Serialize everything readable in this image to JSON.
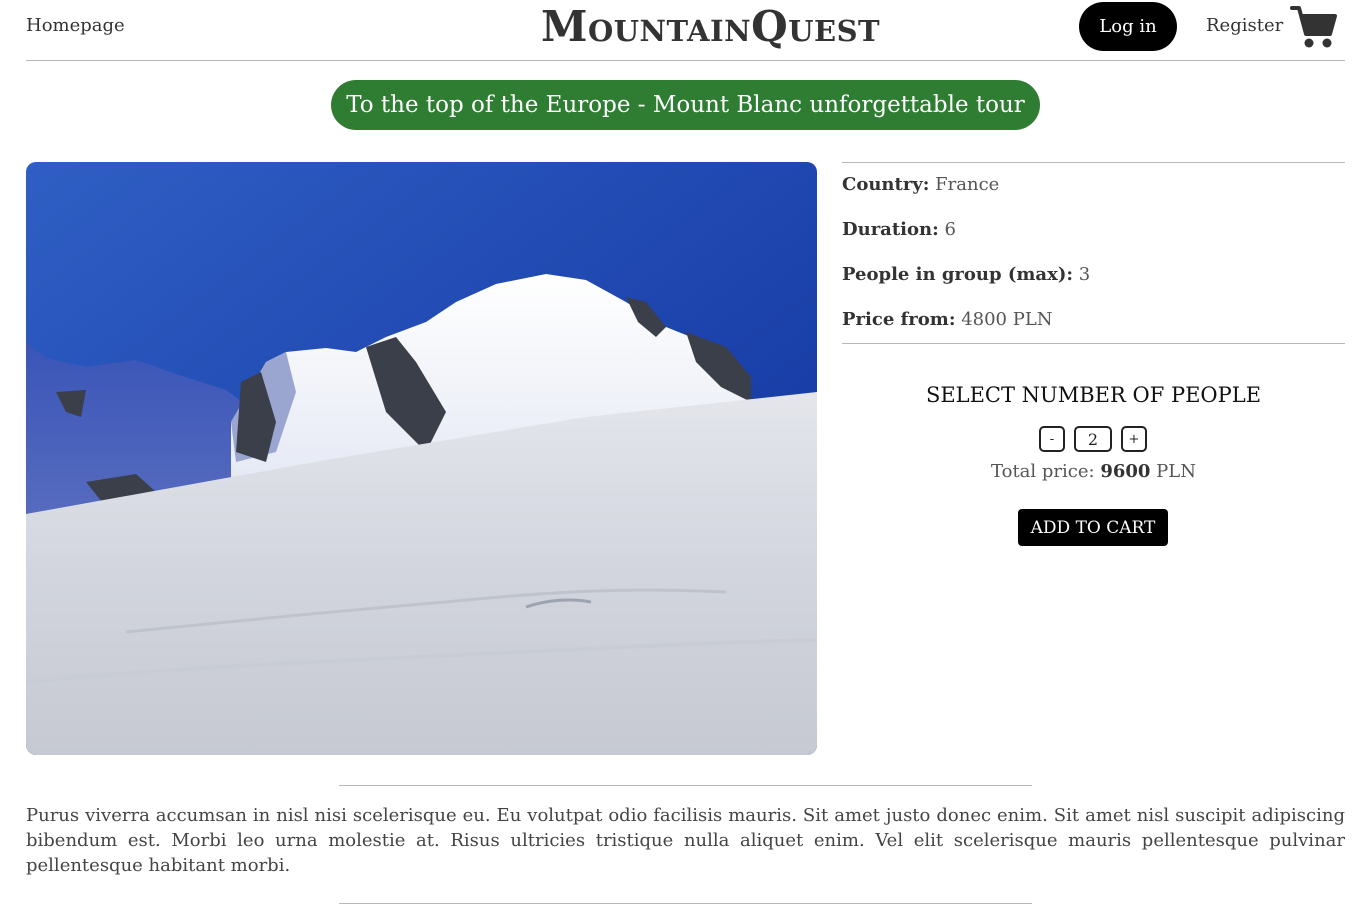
{
  "header": {
    "nav_home": "Homepage",
    "logo": "MountainQuest",
    "login_label": "Log in",
    "register_label": "Register",
    "cart_icon": "shopping-cart-icon"
  },
  "tour": {
    "title": "To the top of the Europe - Mount Blanc unforgettable tour",
    "image_alt": "Snowy summit of Mont Blanc under a blue sky"
  },
  "details": {
    "country_label": "Country:",
    "country": "France",
    "duration_label": "Duration:",
    "duration": "6",
    "group_label": "People in group (max):",
    "group_max": "3",
    "price_label": "Price from:",
    "price": "4800 PLN"
  },
  "booking": {
    "select_title": "SELECT NUMBER OF PEOPLE",
    "minus": "-",
    "quantity": "2",
    "plus": "+",
    "total_label": "Total price:",
    "total_value": "9600",
    "currency": "PLN",
    "add_to_cart": "ADD TO CART"
  },
  "description": "Purus viverra accumsan in nisl nisi scelerisque eu. Eu volutpat odio facilisis mauris. Sit amet justo donec enim. Sit amet nisl suscipit adipiscing bibendum est. Morbi leo urna molestie at. Risus ultricies tristique nulla aliquet enim. Vel elit scelerisque mauris pellentesque pulvinar pellentesque habitant morbi.",
  "colors": {
    "accent_green": "#2e7d32",
    "button_black": "#000000"
  }
}
